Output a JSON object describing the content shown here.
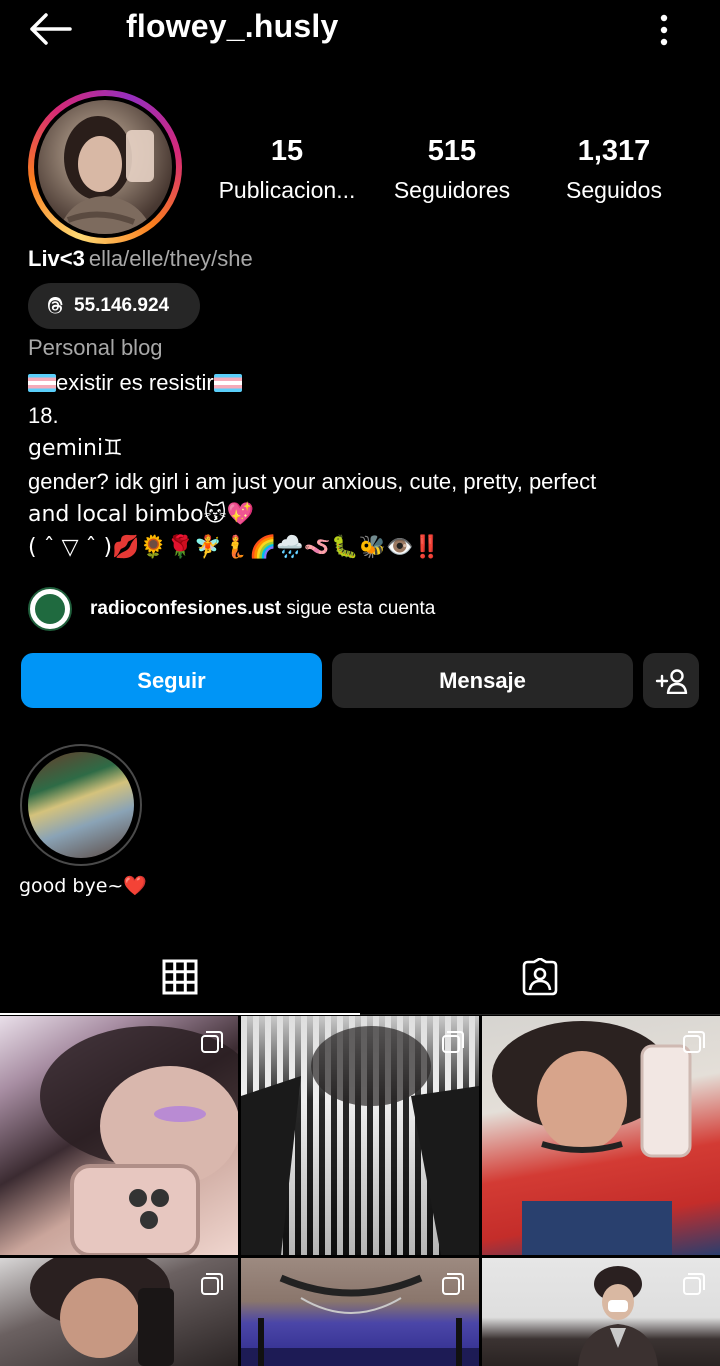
{
  "header": {
    "back_icon": "arrow-left-icon",
    "username": "flowey_.husly",
    "more_icon": "more-vertical-icon"
  },
  "stats": {
    "posts": {
      "value": "15",
      "label": "Publicacion..."
    },
    "followers": {
      "value": "515",
      "label": "Seguidores"
    },
    "following": {
      "value": "1,317",
      "label": "Seguidos"
    }
  },
  "profile": {
    "name": "Liv<3",
    "pronouns": "ella/elle/they/she",
    "threads": {
      "icon": "threads-icon",
      "label": "55.146.924"
    },
    "category": "Personal blog",
    "bio": {
      "line1": "existir es resistir",
      "line2": "18.",
      "line3": "gemini♊",
      "line4": "gender? idk girl i am just your anxious, cute, pretty, perfect",
      "line5": "and local bimbo😽💖",
      "line6": "( ˆ ▽ ˆ )💋🌻🌹🧚🧜🌈🌧️🪱🐛🐝👁️‼️"
    }
  },
  "followed_by": {
    "account": "radioconfesiones.ust",
    "suffix": " sigue esta cuenta"
  },
  "actions": {
    "follow": "Seguir",
    "message": "Mensaje",
    "add_user_icon": "add-user-icon"
  },
  "highlights": [
    {
      "label": "good bye~❤️"
    }
  ],
  "tabs": [
    {
      "icon": "grid-icon",
      "active": true
    },
    {
      "icon": "tagged-icon",
      "active": false
    }
  ],
  "colors": {
    "background": "#000000",
    "follow_button": "#0095f6",
    "secondary_button": "#262626",
    "muted_text": "#a8a8a8"
  }
}
